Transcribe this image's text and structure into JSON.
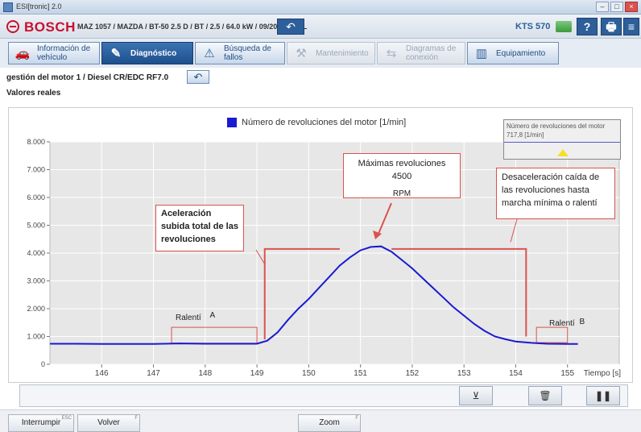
{
  "window": {
    "title": "ESI[tronic] 2.0"
  },
  "header": {
    "brand": "BOSCH",
    "vehicle": "MAZ 1057 / MAZDA / BT-50 2.5 D / BT / 2.5 / 64.0 kW / 09/2007 - / WL",
    "device": "KTS 570",
    "help_label": "?",
    "print_label": "🖶",
    "menu_label": "≡"
  },
  "tabs": [
    {
      "label": "Información de vehículo",
      "icon": "car-info-icon",
      "state": "normal"
    },
    {
      "label": "Diagnóstico",
      "icon": "diagnosis-icon",
      "state": "active"
    },
    {
      "label": "Búsqueda de fallos",
      "icon": "fault-search-icon",
      "state": "normal"
    },
    {
      "label": "Mantenimiento",
      "icon": "maintenance-icon",
      "state": "disabled"
    },
    {
      "label": "Diagramas de conexión",
      "icon": "wiring-diagram-icon",
      "state": "disabled"
    },
    {
      "label": "Equipamiento",
      "icon": "equipment-book-icon",
      "state": "normal"
    }
  ],
  "breadcrumb": "gestión del motor 1 / Diesel CR/EDC RF7.0",
  "subtitle": "Valores reales",
  "readout": {
    "name": "Número de revoluciones del motor",
    "value": "717,8 [1/min]"
  },
  "annotations": {
    "ralenti_a": "Ralentí",
    "ralenti_a_letter": "A",
    "ralenti_b": "Ralentí",
    "ralenti_b_letter": "B",
    "accel": "Aceleración subida total de las revoluciones",
    "max": "Máximas revoluciones 4500",
    "max_unit": "RPM",
    "decel": "Desaceleración caída de las revoluciones hasta marcha mínima o ralentí"
  },
  "controls": {
    "cursor_icon": "cursor-marker-icon",
    "delete_icon": "trash-icon",
    "pause_icon": "pause-icon"
  },
  "bottom_buttons": [
    {
      "label": "Interrumpir",
      "key": "ESC"
    },
    {
      "label": "Volver",
      "key": "F"
    },
    {
      "label": "Zoom",
      "key": "F"
    }
  ],
  "colors": {
    "series": "#1a1ad0",
    "accent": "#2d5f9a",
    "brand": "#c8102e",
    "annotation": "#d9534f",
    "plot_bg": "#e7e7e7"
  },
  "chart_data": {
    "type": "line",
    "title": "",
    "xlabel": "Tiempo [s]",
    "ylabel": "",
    "xlim": [
      145.0,
      156.0
    ],
    "ylim": [
      0,
      8000
    ],
    "x_ticks": [
      146,
      147,
      148,
      149,
      150,
      151,
      152,
      153,
      154,
      155
    ],
    "y_ticks": [
      0,
      1000,
      2000,
      3000,
      4000,
      5000,
      6000,
      7000,
      8000
    ],
    "y_tick_labels": [
      "0",
      "1.000",
      "2.000",
      "3.000",
      "4.000",
      "5.000",
      "6.000",
      "7.000",
      "8.000"
    ],
    "grid": true,
    "legend": "top-center",
    "series": [
      {
        "name": "Número de revoluciones del motor [1/min]",
        "x": [
          145.0,
          145.5,
          146.0,
          146.5,
          147.0,
          147.5,
          148.0,
          148.5,
          149.0,
          149.2,
          149.4,
          149.6,
          149.8,
          150.0,
          150.2,
          150.4,
          150.6,
          150.8,
          151.0,
          151.2,
          151.4,
          151.6,
          151.8,
          152.0,
          152.2,
          152.4,
          152.6,
          152.8,
          153.0,
          153.2,
          153.4,
          153.6,
          153.8,
          154.0,
          154.3,
          154.6,
          155.0,
          155.2
        ],
        "y": [
          740,
          740,
          730,
          730,
          730,
          750,
          740,
          740,
          740,
          850,
          1150,
          1600,
          2000,
          2350,
          2750,
          3150,
          3550,
          3850,
          4100,
          4220,
          4240,
          4050,
          3750,
          3450,
          3100,
          2750,
          2400,
          2050,
          1750,
          1450,
          1200,
          1000,
          900,
          820,
          770,
          740,
          730,
          730
        ]
      }
    ]
  }
}
